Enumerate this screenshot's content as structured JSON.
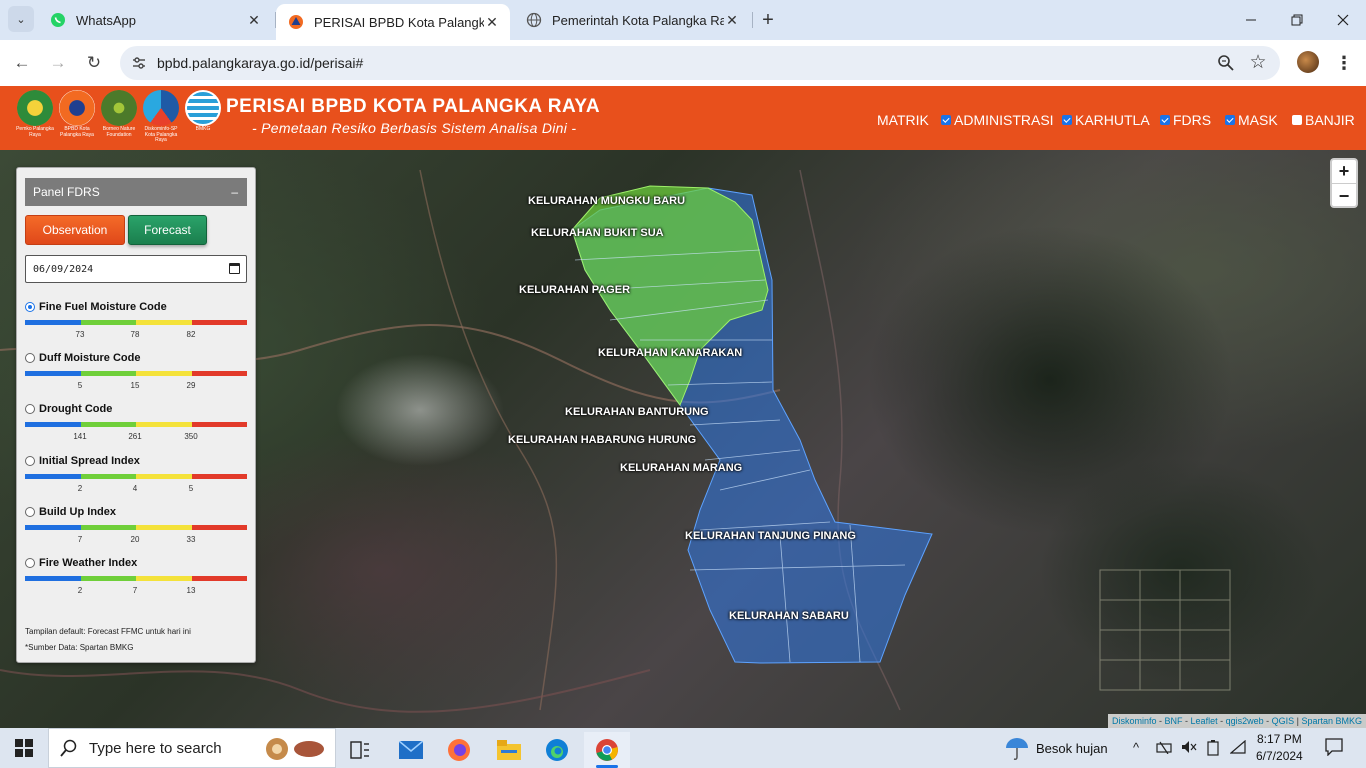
{
  "browser": {
    "tabs": [
      {
        "title": "WhatsApp",
        "icon": "whatsapp-icon"
      },
      {
        "title": "PERISAI BPBD Kota Palangka Ra",
        "icon": "bpbd-icon",
        "active": true
      },
      {
        "title": "Pemerintah Kota Palangka Raya",
        "icon": "globe-icon"
      }
    ],
    "url": "bpbd.palangkaraya.go.id/perisai#"
  },
  "header": {
    "title": "PERISAI BPBD KOTA PALANGKA RAYA",
    "subtitle": "- Pemetaan Resiko Berbasis Sistem Analisa Dini -",
    "logos": [
      {
        "caption": "Pemko Palangka Raya",
        "color": "#2e8b3a"
      },
      {
        "caption": "BPBD Kota Palangka Raya",
        "color": "#f26a21"
      },
      {
        "caption": "Borneo Nature Foundation",
        "color": "#4c7a2a"
      },
      {
        "caption": "Diskominfo-SP Kota Palangka Raya",
        "color": "#1f5aa6"
      },
      {
        "caption": "BMKG",
        "color": "#2a9fd8"
      }
    ],
    "nav": [
      {
        "label": "MATRIK",
        "checkbox": false,
        "checked": false
      },
      {
        "label": "ADMINISTRASI",
        "checkbox": true,
        "checked": true
      },
      {
        "label": "KARHUTLA",
        "checkbox": true,
        "checked": true
      },
      {
        "label": "FDRS",
        "checkbox": true,
        "checked": true
      },
      {
        "label": "MASK",
        "checkbox": true,
        "checked": true
      },
      {
        "label": "BANJIR",
        "checkbox": true,
        "checked": false
      }
    ]
  },
  "panel": {
    "title": "Panel FDRS",
    "collapse_symbol": "–",
    "btn_observation": "Observation",
    "btn_forecast": "Forecast",
    "date_value": "06/09/2024",
    "indices": [
      {
        "name": "Fine Fuel Moisture Code",
        "selected": true,
        "ticks": [
          "73",
          "78",
          "82"
        ]
      },
      {
        "name": "Duff Moisture Code",
        "selected": false,
        "ticks": [
          "5",
          "15",
          "29"
        ]
      },
      {
        "name": "Drought Code",
        "selected": false,
        "ticks": [
          "141",
          "261",
          "350"
        ]
      },
      {
        "name": "Initial Spread Index",
        "selected": false,
        "ticks": [
          "2",
          "4",
          "5"
        ]
      },
      {
        "name": "Build Up Index",
        "selected": false,
        "ticks": [
          "7",
          "20",
          "33"
        ]
      },
      {
        "name": "Fire Weather Index",
        "selected": false,
        "ticks": [
          "2",
          "7",
          "13"
        ]
      }
    ],
    "scale_colors": [
      "#1f6fe0",
      "#6fcf3a",
      "#f4e23a",
      "#e23a2a"
    ],
    "footer_default": "Tampilan default: Forecast FFMC untuk hari ini",
    "footer_source": "*Sumber Data: Spartan BMKG"
  },
  "map": {
    "kelurahan": [
      "KELURAHAN MUNGKU BARU",
      "KELURAHAN BUKIT SUA",
      "KELURAHAN PAGER",
      "KELURAHAN KANARAKAN",
      "KELURAHAN BANTURUNG",
      "KELURAHAN HABARUNG HURUNG",
      "KELURAHAN MARANG",
      "KELURAHAN TANJUNG PINANG",
      "KELURAHAN SABARU"
    ],
    "zoom_in": "+",
    "zoom_out": "−",
    "attribution_parts": [
      "Diskominfo",
      "BNF",
      "Leaflet",
      "qgis2web",
      "QGIS",
      "Spartan BMKG"
    ],
    "fdrs_fill_colors": {
      "low": "#2e6fe8",
      "moderate": "#69c83a"
    }
  },
  "taskbar": {
    "search_placeholder": "Type here to search",
    "weather": "Besok hujan",
    "time": "8:17 PM",
    "date": "6/7/2024"
  }
}
